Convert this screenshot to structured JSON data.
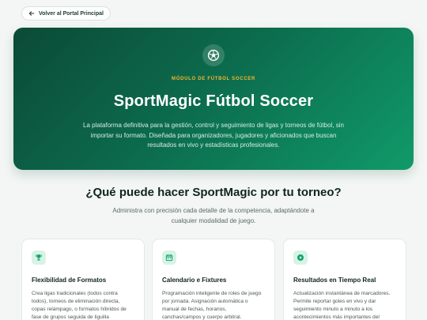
{
  "back_button": {
    "label": "Volver al Portal Principal",
    "icon": "arrow-left-icon"
  },
  "hero": {
    "icon": "soccer-ball-icon",
    "eyebrow": "MÓDULO DE FÚTBOL SOCCER",
    "title": "SportMagic Fútbol Soccer",
    "description": "La plataforma definitiva para la gestión, control y seguimiento de ligas y torneos de fútbol, sin importar su formato. Diseñada para organizadores, jugadores y aficionados que buscan resultados en vivo y estadísticas profesionales."
  },
  "features": {
    "title": "¿Qué puede hacer SportMagic por tu torneo?",
    "subtitle": "Administra con precisión cada detalle de la competencia, adaptándote a cualquier modalidad de juego.",
    "cards": [
      {
        "icon": "trophy-icon",
        "title": "Flexibilidad de Formatos",
        "description": "Crea ligas tradicionales (todos contra todos), torneos de eliminación directa, copas relámpago, o formatos híbridos de fase de grupos seguida de liguilla"
      },
      {
        "icon": "calendar-icon",
        "title": "Calendario e Fixtures",
        "description": "Programación inteligente de roles de juego por jornada. Asignación automática o manual de fechas, horarios, canchas/campos y cuerpo arbitral."
      },
      {
        "icon": "play-circle-icon",
        "title": "Resultados en Tiempo Real",
        "description": "Actualización instantánea de marcadores. Permite reportar goles en vivo y dar seguimiento minuto a minuto a los acontecimientos más importantes del"
      }
    ]
  },
  "colors": {
    "hero_start": "#0b4a37",
    "hero_end": "#109a6a",
    "accent_gold": "#f4b52e",
    "icon_bg": "#d7f3e6",
    "icon_fg": "#12a36c"
  }
}
